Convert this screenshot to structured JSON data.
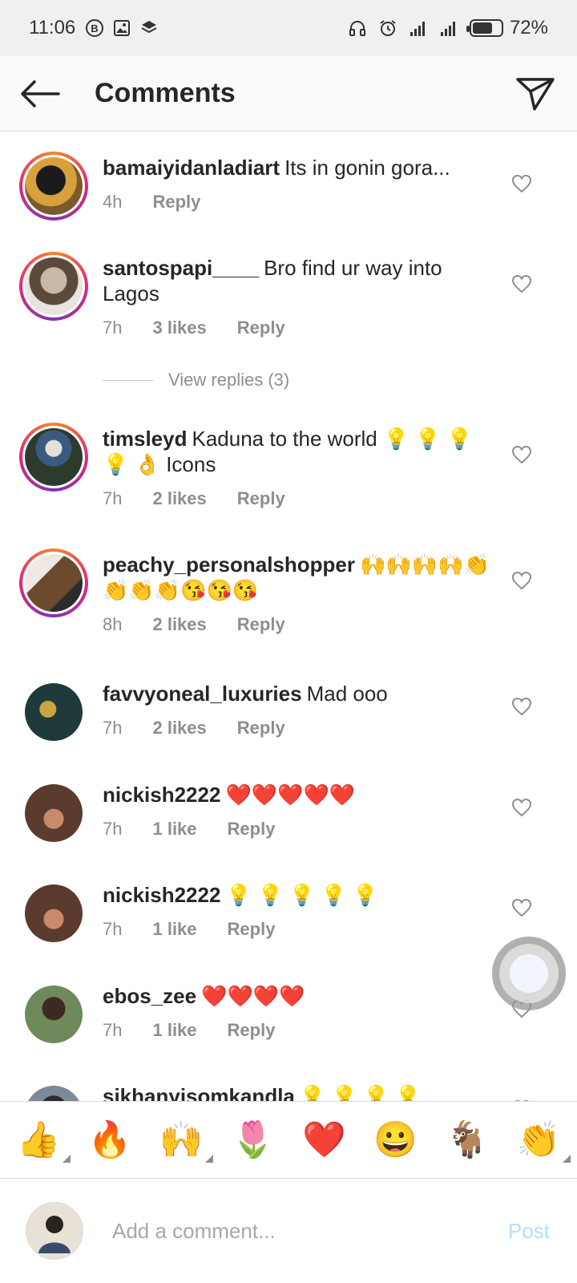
{
  "status_bar": {
    "time": "11:06",
    "battery": "72%",
    "battery_level": 0.72
  },
  "header": {
    "title": "Comments"
  },
  "comments": [
    {
      "user": "bamaiyidanladiart",
      "text": "Its in gonin gora...",
      "time": "4h",
      "likes": "",
      "reply": "Reply"
    },
    {
      "user": "santospapi____",
      "text": "Bro find ur way into Lagos",
      "time": "7h",
      "likes": "3 likes",
      "reply": "Reply"
    },
    {
      "user": "timsleyd",
      "text": "Kaduna to the world 💡 💡 💡 💡 👌 Icons",
      "time": "7h",
      "likes": "2 likes",
      "reply": "Reply"
    },
    {
      "user": "peachy_personalshopper",
      "text": "🙌🙌🙌🙌👏👏👏👏😘😘😘",
      "time": "8h",
      "likes": "2 likes",
      "reply": "Reply"
    },
    {
      "user": "favvyoneal_luxuries",
      "text": "Mad ooo",
      "time": "7h",
      "likes": "2 likes",
      "reply": "Reply"
    },
    {
      "user": "nickish2222",
      "text": "❤️❤️❤️❤️❤️",
      "time": "7h",
      "likes": "1 like",
      "reply": "Reply"
    },
    {
      "user": "nickish2222",
      "text": "💡 💡 💡 💡 💡",
      "time": "7h",
      "likes": "1 like",
      "reply": "Reply"
    },
    {
      "user": "ebos_zee",
      "text": "❤️❤️❤️❤️",
      "time": "7h",
      "likes": "1 like",
      "reply": "Reply"
    },
    {
      "user": "sikhanyisomkandla",
      "text": "💡 💡 💡 💡",
      "time": "",
      "likes": "",
      "reply": ""
    }
  ],
  "view_replies": "View replies (3)",
  "quick_emojis": [
    "👍",
    "🔥",
    "🙌",
    "🌷",
    "❤️",
    "😀",
    "🐐",
    "👏"
  ],
  "composer": {
    "placeholder": "Add a comment...",
    "post_label": "Post"
  },
  "colors": {
    "accent_post_disabled": "#b2dffc",
    "meta_gray": "#8e8e8e",
    "text": "#262626"
  }
}
